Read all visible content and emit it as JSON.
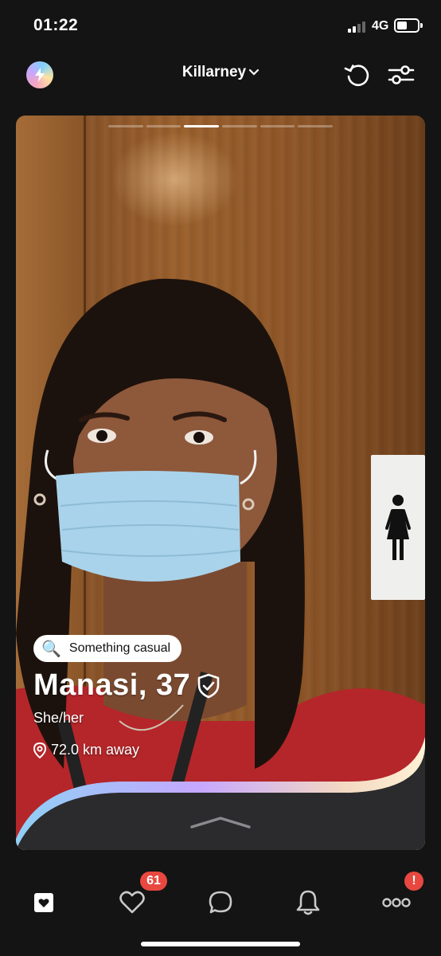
{
  "status_bar": {
    "time": "01:22",
    "network": "4G"
  },
  "header": {
    "location": "Killarney"
  },
  "profile": {
    "intent": "Something casual",
    "intent_emoji": "🔍",
    "name_age": "Manasi, 37",
    "pronouns": "She/her",
    "distance": "72.0 km away",
    "photo_index": 3,
    "photo_count": 6
  },
  "nav": {
    "likes_badge": "61",
    "more_badge": "!"
  },
  "colors": {
    "background": "#141414",
    "badge": "#e8483f",
    "accent_gradient": [
      "#7fd2ff",
      "#c6a7ff",
      "#ffe3a1"
    ]
  }
}
